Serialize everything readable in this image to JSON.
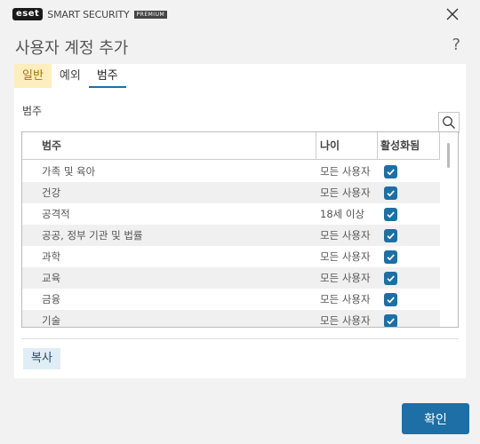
{
  "titlebar": {
    "logo_text": "eset",
    "product_name": "SMART SECURITY",
    "edition_badge": "PREMIUM"
  },
  "page": {
    "title": "사용자 계정 추가",
    "help": "?"
  },
  "tabs": [
    {
      "label": "일반",
      "highlighted": true,
      "active": false
    },
    {
      "label": "예외",
      "highlighted": false,
      "active": false
    },
    {
      "label": "범주",
      "highlighted": false,
      "active": true
    }
  ],
  "section_label": "범주",
  "table": {
    "headers": {
      "category": "범주",
      "age": "나이",
      "enabled": "활성화됨"
    },
    "rows": [
      {
        "category": "가족 및 육아",
        "age": "모든 사용자",
        "enabled": true
      },
      {
        "category": "건강",
        "age": "모든 사용자",
        "enabled": true
      },
      {
        "category": "공격적",
        "age": "18세 이상",
        "enabled": true
      },
      {
        "category": "공공, 정부 기관 및 법률",
        "age": "모든 사용자",
        "enabled": true
      },
      {
        "category": "과학",
        "age": "모든 사용자",
        "enabled": true
      },
      {
        "category": "교육",
        "age": "모든 사용자",
        "enabled": true
      },
      {
        "category": "금융",
        "age": "모든 사용자",
        "enabled": true
      },
      {
        "category": "기술",
        "age": "모든 사용자",
        "enabled": true
      }
    ]
  },
  "buttons": {
    "copy": "복사",
    "ok": "확인"
  },
  "colors": {
    "accent": "#1d6fa5",
    "tab_highlight": "#fdeebf",
    "copy_button_bg": "#e0edf5"
  }
}
